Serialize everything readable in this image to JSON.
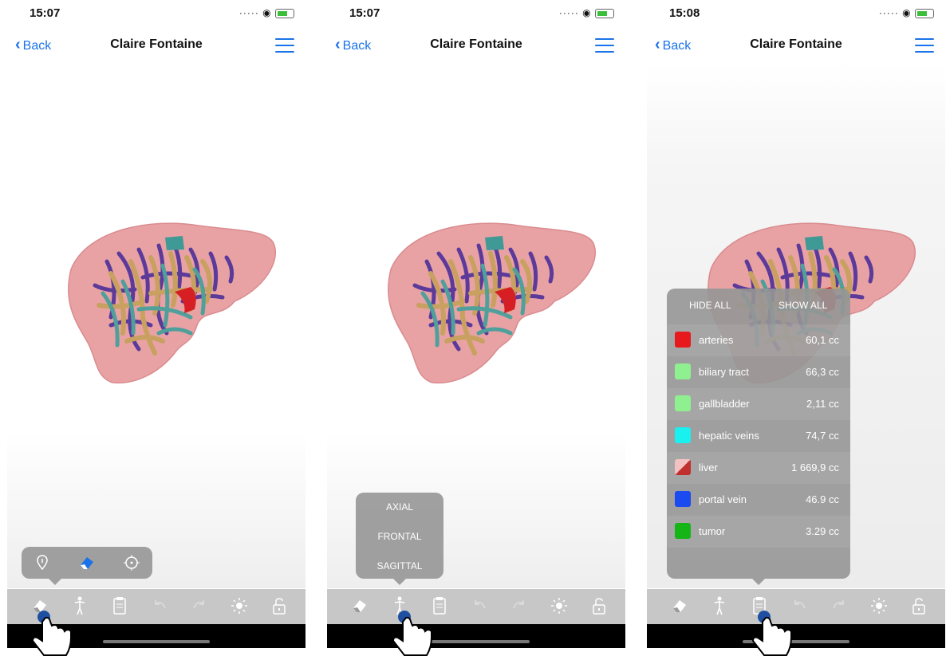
{
  "screens": [
    {
      "time": "15:07",
      "back_label": "Back",
      "title": "Claire Fontaine",
      "tool_popup": {
        "icons": [
          "pin-icon",
          "eraser-icon",
          "crosshair-icon"
        ],
        "active": "eraser-icon"
      },
      "toolbar_active": "eraser"
    },
    {
      "time": "15:07",
      "back_label": "Back",
      "title": "Claire Fontaine",
      "view_popup": {
        "options": [
          "AXIAL",
          "FRONTAL",
          "SAGITTAL"
        ]
      },
      "toolbar_active": "body"
    },
    {
      "time": "15:08",
      "back_label": "Back",
      "title": "Claire Fontaine",
      "organ_popup": {
        "hide_all_label": "HIDE ALL",
        "show_all_label": "SHOW ALL",
        "organs": [
          {
            "name": "arteries",
            "volume": "60,1 cc",
            "color": "#e8191c"
          },
          {
            "name": "biliary tract",
            "volume": "66,3 cc",
            "color": "#8ef08e"
          },
          {
            "name": "gallbladder",
            "volume": "2,11 cc",
            "color": "#8ef08e"
          },
          {
            "name": "hepatic veins",
            "volume": "74,7 cc",
            "color": "#19f0f0"
          },
          {
            "name": "liver",
            "volume": "1 669,9 cc",
            "color": "#c0302e"
          },
          {
            "name": "portal vein",
            "volume": "46.9 cc",
            "color": "#1a4af0"
          },
          {
            "name": "tumor",
            "volume": "3.29 cc",
            "color": "#15b515"
          }
        ]
      },
      "toolbar_active": "report"
    }
  ],
  "toolbar": {
    "icons": [
      "eraser-icon",
      "body-icon",
      "report-icon",
      "undo-icon",
      "redo-icon",
      "brightness-icon",
      "unlock-icon"
    ]
  },
  "colors": {
    "accent": "#1a73e8",
    "toolbar": "#c7c7c7",
    "liver": "#e8a2a4"
  }
}
